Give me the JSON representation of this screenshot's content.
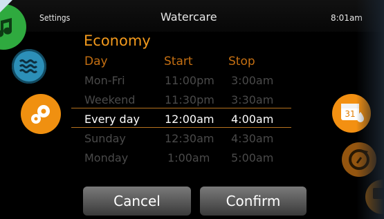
{
  "header": {
    "left": "Settings",
    "title": "Watercare",
    "time": "8:01am"
  },
  "program": {
    "name": "Economy",
    "columns": [
      "Day",
      "Start",
      "Stop"
    ],
    "rows": [
      {
        "day": "Mon-Fri",
        "start": "11:00pm",
        "stop": "3:00am"
      },
      {
        "day": "Weekend",
        "start": "11:30pm",
        "stop": "3:30am"
      },
      {
        "day": "Every day",
        "start": "12:00am",
        "stop": "4:00am"
      },
      {
        "day": "Sunday",
        "start": "12:30am",
        "stop": "4:30am"
      },
      {
        "day": "Monday",
        "start": "1:00am",
        "stop": "5:00am"
      }
    ]
  },
  "buttons": {
    "cancel": "Cancel",
    "confirm": "Confirm"
  },
  "calendar_icon_text": "31"
}
